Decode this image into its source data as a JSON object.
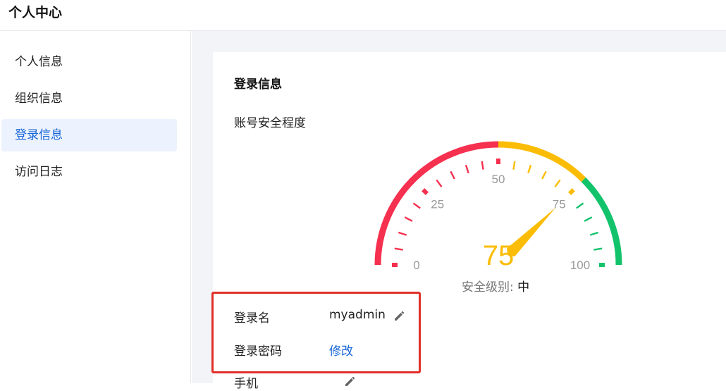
{
  "header": {
    "title": "个人中心"
  },
  "sidebar": {
    "items": [
      {
        "label": "个人信息"
      },
      {
        "label": "组织信息"
      },
      {
        "label": "登录信息",
        "active": true
      },
      {
        "label": "访问日志"
      }
    ]
  },
  "main": {
    "section_title": "登录信息",
    "security_title": "账号安全程度",
    "gauge": {
      "value": 75,
      "min": 0,
      "max": 100,
      "tick_labels": [
        "0",
        "25",
        "50",
        "75",
        "100"
      ],
      "value_text": "75",
      "level_label": "安全级别:",
      "level_value": "中",
      "colors": {
        "low": "#f6304f",
        "mid": "#fbbc05",
        "high": "#13c36b"
      }
    },
    "fields": {
      "login_name_label": "登录名",
      "login_name_value": "myadmin",
      "password_label": "登录密码",
      "password_action": "修改",
      "phone_label": "手机"
    },
    "edit_icon": "pencil-icon"
  }
}
